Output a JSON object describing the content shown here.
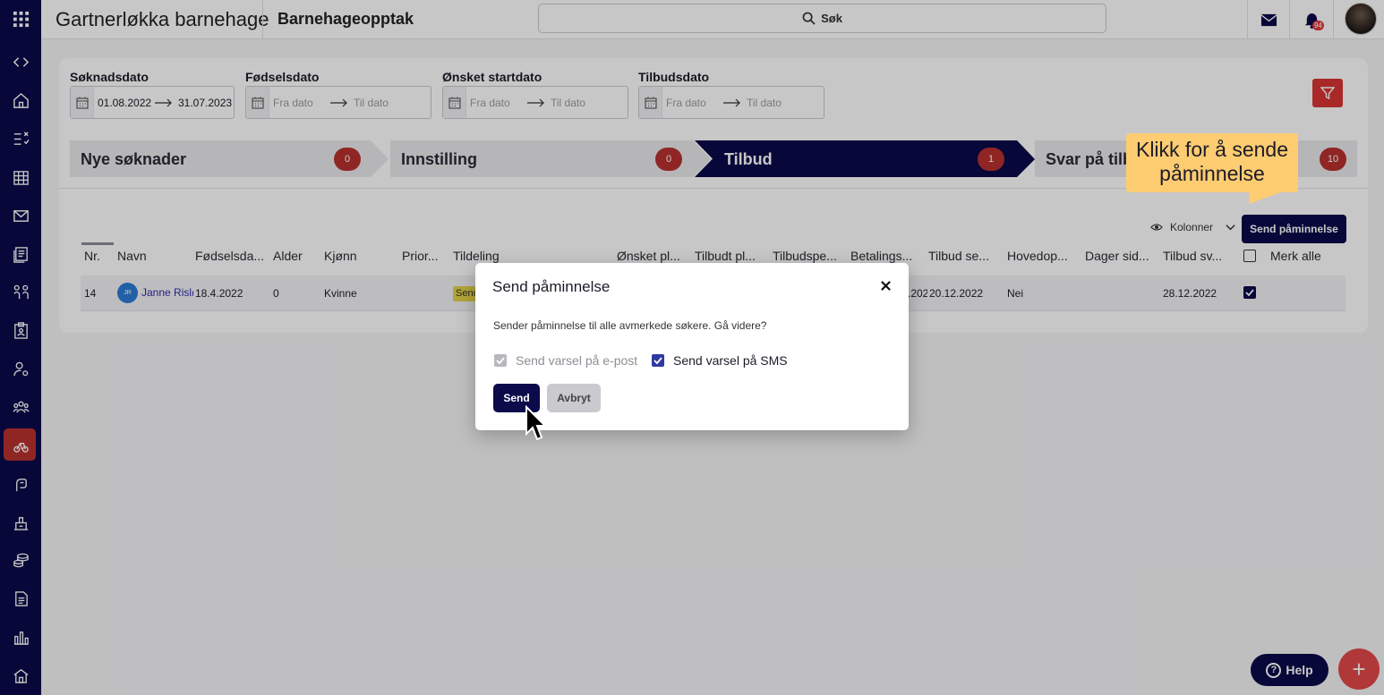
{
  "header": {
    "org_name": "Gartnerløkka barnehage",
    "module_title": "Barnehageopptak",
    "search_placeholder": "Søk",
    "notification_count": "94"
  },
  "filters": [
    {
      "label": "Søknadsdato",
      "from": "01.08.2022",
      "to": "31.07.2023"
    },
    {
      "label": "Fødselsdato",
      "from": "Fra dato",
      "to": "Til dato"
    },
    {
      "label": "Ønsket startdato",
      "from": "Fra dato",
      "to": "Til dato"
    },
    {
      "label": "Tilbudsdato",
      "from": "Fra dato",
      "to": "Til dato"
    }
  ],
  "stages": [
    {
      "label": "Nye søknader",
      "count": "0"
    },
    {
      "label": "Innstilling",
      "count": "0"
    },
    {
      "label": "Tilbud",
      "count": "1",
      "active": true
    },
    {
      "label": "Svar på tilbud",
      "count": "10"
    }
  ],
  "toolbar": {
    "columns_label": "Kolonner",
    "send_reminder_label": "Send påminnelse",
    "mark_all_label": "Merk alle"
  },
  "table": {
    "columns": [
      "Nr.",
      "Navn",
      "Fødselsda...",
      "Alder",
      "Kjønn",
      "Prior...",
      "Tildeling",
      "Ønsket pl...",
      "Tilbudt pl...",
      "Tilbudspe...",
      "Betalings...",
      "Tilbud se...",
      "Hovedop...",
      "Dager sid...",
      "Tilbud sv..."
    ],
    "rows": [
      {
        "nr": "14",
        "initials": "JR",
        "name": "Janne Rislø",
        "birthdate": "18.4.2022",
        "age": "0",
        "gender": "Kvinne",
        "allocation": "Send",
        "payment_partial": ".202",
        "offer_sent": "20.12.2022",
        "main_applicant": "Nei",
        "offer_reply": "28.12.2022",
        "checked": true
      }
    ]
  },
  "callout": {
    "text": "Klikk for å sende påminnelse"
  },
  "modal": {
    "title": "Send påminnelse",
    "message": "Sender påminnelse til alle avmerkede søkere. Gå videre?",
    "email_option": "Send varsel på e-post",
    "sms_option": "Send varsel på SMS",
    "email_checked": true,
    "sms_checked": true,
    "send_label": "Send",
    "cancel_label": "Avbryt"
  },
  "help": {
    "label": "Help"
  },
  "colors": {
    "navy": "#0b0a4a",
    "red": "#b8312f",
    "callout": "#fecc71"
  }
}
